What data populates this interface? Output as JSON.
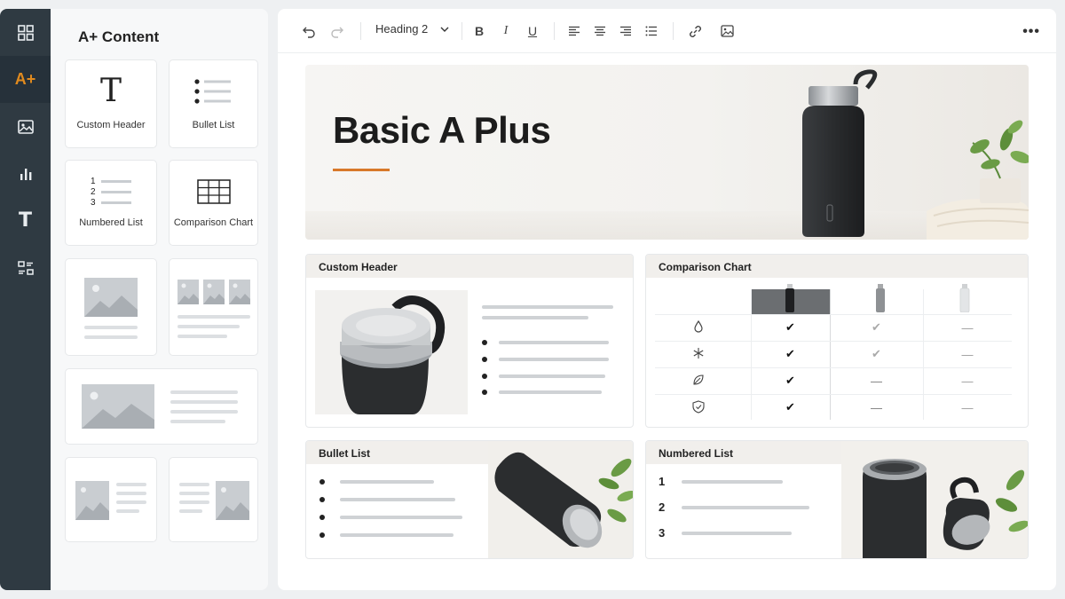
{
  "panel": {
    "title": "A+ Content",
    "modules": [
      {
        "label": "Custom Header"
      },
      {
        "label": "Bullet List"
      },
      {
        "label": "Numbered List"
      },
      {
        "label": "Comparison Chart"
      }
    ],
    "numbered_preview": [
      "1",
      "2",
      "3"
    ]
  },
  "toolbar": {
    "heading_select": "Heading 2",
    "bold": "B",
    "italic": "I",
    "underline": "U",
    "more": "•••"
  },
  "document": {
    "hero_title": "Basic A Plus",
    "cards": {
      "custom_header": "Custom Header",
      "comparison_chart": "Comparison Chart",
      "bullet_list": "Bullet List",
      "numbered_list": "Numbered List"
    },
    "numbered_items": [
      "1",
      "2",
      "3"
    ],
    "comparison_rows": [
      {
        "icon": "droplet-icon",
        "values": [
          "✔",
          "✔",
          "—"
        ],
        "tones": [
          "dark",
          "light",
          "light"
        ]
      },
      {
        "icon": "snowflake-icon",
        "values": [
          "✔",
          "✔",
          "—"
        ],
        "tones": [
          "dark",
          "light",
          "light"
        ]
      },
      {
        "icon": "leaf-icon",
        "values": [
          "✔",
          "—",
          "—"
        ],
        "tones": [
          "dark",
          "light",
          "light"
        ]
      },
      {
        "icon": "shield-icon",
        "values": [
          "✔",
          "—",
          "—"
        ],
        "tones": [
          "dark",
          "light",
          "light"
        ]
      }
    ]
  },
  "colors": {
    "accent": "#d8782a",
    "rail_bg": "#2f3a42",
    "aplus_orange": "#e08a1e"
  }
}
